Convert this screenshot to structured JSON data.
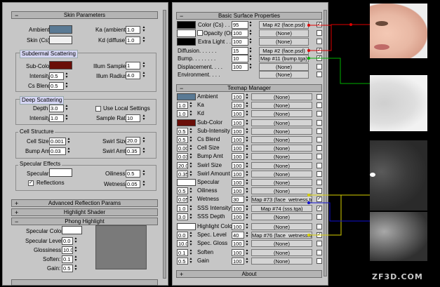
{
  "skin": {
    "title": "Skin Parameters",
    "ambient": "Ambient",
    "skin": "Skin (Cs)",
    "ka": "Ka (ambient)",
    "ka_val": "1.0",
    "kd": "Kd (diffuse)",
    "kd_val": "1.0",
    "subdermal": "Subdermal Scattering",
    "subcolor": "Sub-Color",
    "intensity": "Intensity",
    "intensity_val": "0.5",
    "csblend": "Cs Blend",
    "csblend_val": "0.5",
    "illum_samples": "Illum Samples",
    "illum_samples_val": "1",
    "illum_radius": "Illum Radius",
    "illum_radius_val": "4.0",
    "deep": "Deep Scattering",
    "depth": "Depth",
    "depth_val": "3.0",
    "deep_int": "Intensity",
    "deep_int_val": "1.0",
    "local": "Use Local Settings",
    "samplerate": "Sample Rate",
    "samplerate_val": "10",
    "cell": "Cell Structure",
    "cellsize": "Cell Size",
    "cellsize_val": "0.001",
    "swirlsize": "Swirl Size",
    "swirlsize_val": "20.0",
    "bumpamt": "Bump Amt",
    "bumpamt_val": "0.03",
    "swirlamt": "Swirl Amt",
    "swirlamt_val": "0.35",
    "spec": "Specular Effects",
    "specular": "Specular",
    "oiliness": "Oiliness",
    "oiliness_val": "0.5",
    "reflections": "Reflections",
    "wetness": "Wetness",
    "wetness_val": "0.05"
  },
  "adv": "Advanced Reflection Params",
  "hl": "Highlight Shader",
  "phong": {
    "title": "Phong Highlight",
    "color": "Specular Color:",
    "level": "Specular Level:",
    "level_val": "0.0",
    "gloss": "Glossiness:",
    "gloss_val": "10.0",
    "soften": "Soften:",
    "soften_val": "0.1",
    "gain": "Gain:",
    "gain_val": "0.5"
  },
  "basic": {
    "title": "Basic Surface Properties",
    "color": "Color (Cs) . . . .",
    "color_val": "95",
    "color_map": "Map #2 (face.psd)",
    "opacity": "Opacity (Os)",
    "opacity_val": "100",
    "opacity_map": "(None)",
    "extra": "Extra Light . . .",
    "extra_val": "100",
    "extra_map": "(None)",
    "diffusion": "Diffusion. . . . . .",
    "diffusion_val": "15",
    "diffusion_map": "Map #2 (face.psd)",
    "bump": "Bump. . . . . . . .",
    "bump_val": "10",
    "bump_map": "Map #11 (bump.tga)",
    "disp": "Displacement. . . .",
    "disp_val": "100",
    "disp_map": "(None)",
    "env": "Environment. . . .",
    "env_map": "(None)"
  },
  "texmap": {
    "title": "Texmap Manager",
    "rows": [
      {
        "name": "Ambient",
        "val": "",
        "amt": "100",
        "map": "(None)",
        "swatch": "#5a7a94"
      },
      {
        "name": "Ka",
        "val": "1.0",
        "amt": "100",
        "map": "(None)"
      },
      {
        "name": "Kd",
        "val": "1.0",
        "amt": "100",
        "map": "(None)"
      },
      {
        "name": "Sub-Color",
        "val": "",
        "amt": "100",
        "map": "(None)",
        "swatch": "#6a0e08"
      },
      {
        "name": "Sub-Intensity",
        "val": "0.5",
        "amt": "100",
        "map": "(None)"
      },
      {
        "name": "Cs Blend",
        "val": "0.5",
        "amt": "100",
        "map": "(None)"
      },
      {
        "name": "Cell Size",
        "val": "0.001",
        "amt": "100",
        "map": "(None)"
      },
      {
        "name": "Bump Amt",
        "val": "0.03",
        "amt": "100",
        "map": "(None)"
      },
      {
        "name": "Swirl Size",
        "val": "20.0",
        "amt": "100",
        "map": "(None)"
      },
      {
        "name": "Swirl Amount",
        "val": "0.35",
        "amt": "100",
        "map": "(None)"
      },
      {
        "name": "Specular",
        "val": "",
        "amt": "100",
        "map": "(None)",
        "swatch": "#ffffff"
      },
      {
        "name": "Oiliness",
        "val": "0.5",
        "amt": "100",
        "map": "(None)"
      },
      {
        "name": "Wetness",
        "val": "0.05",
        "amt": "30",
        "map": "Map #73 (face_wetness.tga)",
        "checked": true
      },
      {
        "name": "SSS Intensity",
        "val": "1.0",
        "amt": "100",
        "map": "Map #74 (sss.tga)",
        "checked": true
      },
      {
        "name": "SSS Depth",
        "val": "3.0",
        "amt": "100",
        "map": "(None)"
      }
    ],
    "rows2": [
      {
        "name": "Highlight Color",
        "val": "",
        "amt": "100",
        "map": "(None)",
        "swatch": "#ffffff"
      },
      {
        "name": "Spec. Level",
        "val": "0.0",
        "amt": "40",
        "map": "Map #76 (face_wetness.tga)",
        "checked": true
      },
      {
        "name": "Spec. Gloss",
        "val": "10.0",
        "amt": "100",
        "map": "(None)"
      },
      {
        "name": "Soften",
        "val": "0.1",
        "amt": "100",
        "map": "(None)"
      },
      {
        "name": "Gain",
        "val": "0.5",
        "amt": "100",
        "map": "(None)"
      }
    ]
  },
  "about": "About",
  "watermark": "ZF3D.COM"
}
